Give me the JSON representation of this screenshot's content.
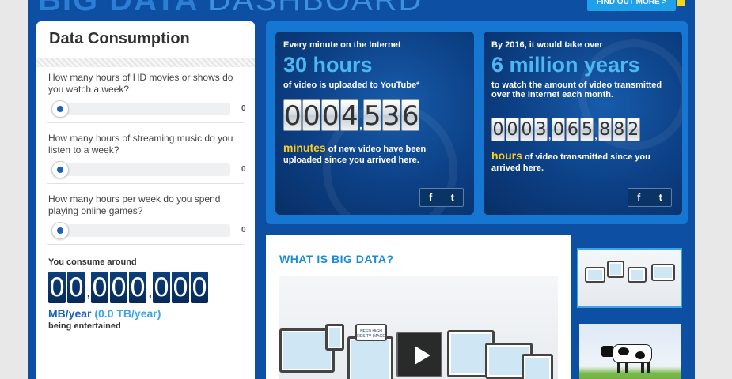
{
  "header": {
    "title_bold": "BIG DATA",
    "title_thin": "DASHBOARD",
    "cta_label": "FIND OUT MORE >"
  },
  "consumption": {
    "title": "Data Consumption",
    "questions": [
      {
        "text": "How many hours of HD movies or shows do you watch a week?",
        "value": "0"
      },
      {
        "text": "How many hours of streaming music do you listen to a week?",
        "value": "0"
      },
      {
        "text": "How many hours per week do you spend playing online games?",
        "value": "0"
      }
    ],
    "result_label": "You consume around",
    "result_digits": [
      "0",
      "0",
      ",",
      "0",
      "0",
      "0",
      ",",
      "0",
      "0",
      "0"
    ],
    "unit": "MB/year",
    "unit_tb": "(0.0 TB/year)",
    "note": "being entertained"
  },
  "stats": [
    {
      "head": "Every minute on the Internet",
      "big": "30 hours",
      "sub": "of video is uploaded to YouTube*",
      "counter": [
        "0",
        "0",
        "0",
        "4",
        ",",
        "5",
        "3",
        "6"
      ],
      "foot_hl": "minutes",
      "foot": " of new video have been uploaded since you arrived here.",
      "share_fb": "f",
      "share_tw": "t"
    },
    {
      "head": "By 2016, it would take over",
      "big": "6 million years",
      "sub": "to watch the amount of video transmitted over the Internet each month.",
      "counter": [
        "0",
        "0",
        "0",
        "3",
        ",",
        "0",
        "6",
        "5",
        ",",
        "8",
        "8",
        "2"
      ],
      "foot_hl": "hours",
      "foot": " of video transmitted since you arrived here.",
      "share_fb": "f",
      "share_tw": "t"
    }
  ],
  "video": {
    "title": "WHAT IS BIG DATA?",
    "screen_caption": "NEED HIGH RES TV IMAGE"
  },
  "colors": {
    "brand_blue": "#0d4fa3",
    "accent_light": "#4cb8f2",
    "highlight_yellow": "#ffcc1f"
  }
}
